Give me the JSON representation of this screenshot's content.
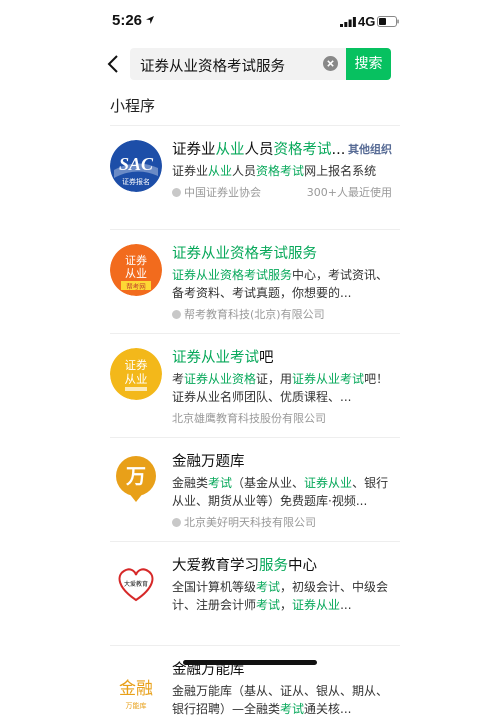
{
  "status_bar": {
    "time": "5:26",
    "network": "4G"
  },
  "search": {
    "query": "证券从业资格考试服务",
    "button_label": "搜索"
  },
  "section_title": "小程序",
  "results": [
    {
      "title": [
        "证券业",
        "从业",
        "人员",
        "资格考试",
        "..."
      ],
      "tag": "其他组织",
      "desc": [
        "证券业",
        "从业",
        "人员",
        "资格考试",
        "网上报名系统"
      ],
      "org": "中国证券业协会",
      "users": "300+人最近使用",
      "logo_text": "SAC",
      "logo_sub": "证券报名"
    },
    {
      "title": [
        "证券从业资格考试服务"
      ],
      "desc": [
        "证券从业资格考试服务",
        "中心，考试资讯、备考资料、考试真题，你想要的..."
      ],
      "org": "帮考教育科技(北京)有限公司",
      "logo_line1": "证券",
      "logo_line2": "从业",
      "logo_sub": "帮考网"
    },
    {
      "title": [
        "证券从业考试",
        "吧"
      ],
      "desc": [
        "考",
        "证券从业资格",
        "证，用",
        "证券从业考试",
        "吧！证券从业名师团队、优质课程、..."
      ],
      "org": "北京雄鹰教育科技股份有限公司",
      "logo_line1": "证券",
      "logo_line2": "从业"
    },
    {
      "title": [
        "金融万题库"
      ],
      "desc": [
        "金融类",
        "考试",
        "（基金从业、",
        "证券从业",
        "、银行从业、期货从业等）免费题库·视频..."
      ],
      "org": "北京美好明天科技有限公司",
      "logo_text": "万"
    },
    {
      "title": [
        "大爱教育学习",
        "服务",
        "中心"
      ],
      "desc": [
        "全国计算机等级",
        "考试",
        "，初级会计、中级会计、注册会计师",
        "考试",
        "，",
        "证券从业",
        "..."
      ],
      "logo_text": "大爱教育"
    },
    {
      "title": [
        "金融万能库"
      ],
      "desc": [
        "金融万能库（基从、证从、银从、期从、银行招聘）—全融类",
        "考试",
        "通关核..."
      ],
      "logo_text": "金融",
      "logo_sub": "万能库"
    }
  ]
}
